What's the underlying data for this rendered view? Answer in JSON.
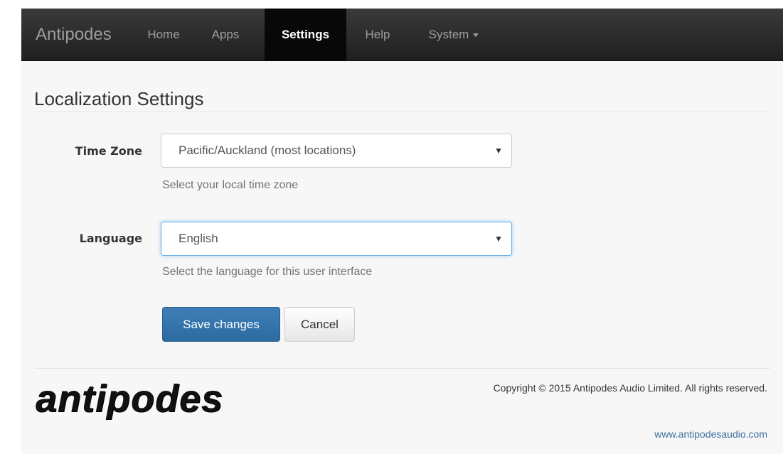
{
  "navbar": {
    "brand": "Antipodes",
    "items": [
      {
        "label": "Home"
      },
      {
        "label": "Apps"
      },
      {
        "label": "Settings",
        "active": true
      },
      {
        "label": "Help"
      },
      {
        "label": "System",
        "dropdown": true
      }
    ]
  },
  "page": {
    "title": "Localization Settings"
  },
  "form": {
    "timezone": {
      "label": "Time Zone",
      "value": "Pacific/Auckland (most locations)",
      "help": "Select your local time zone"
    },
    "language": {
      "label": "Language",
      "value": "English",
      "help": "Select the language for this user interface"
    },
    "save_label": "Save changes",
    "cancel_label": "Cancel"
  },
  "footer": {
    "logo_text": "antipodes",
    "copyright": "Copyright © 2015 Antipodes Audio Limited. All rights reserved.",
    "website": "www.antipodesaudio.com"
  },
  "colors": {
    "navbar_bg": "#222222",
    "primary_button": "#337ab7",
    "focus_border": "#66afe9"
  }
}
